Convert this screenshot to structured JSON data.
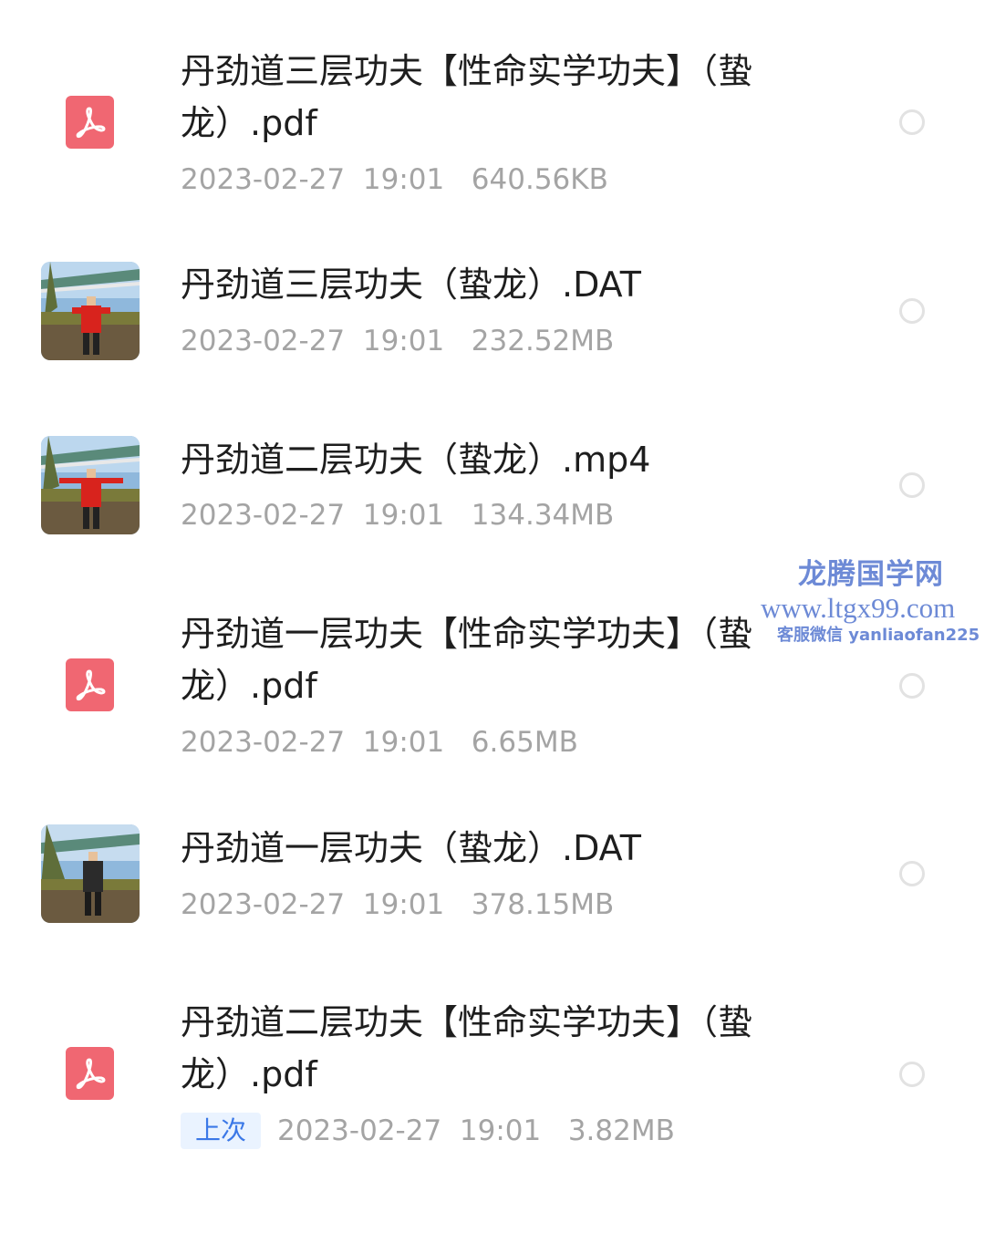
{
  "files": [
    {
      "name": "丹劲道三层功夫【性命实学功夫】（蛰龙）.pdf",
      "date": "2023-02-27",
      "time": "19:01",
      "size": "640.56KB",
      "icon": "pdf-icon"
    },
    {
      "name": "丹劲道三层功夫（蛰龙）.DAT",
      "date": "2023-02-27",
      "time": "19:01",
      "size": "232.52MB",
      "icon": "video-thumbnail"
    },
    {
      "name": "丹劲道二层功夫（蛰龙）.mp4",
      "date": "2023-02-27",
      "time": "19:01",
      "size": "134.34MB",
      "icon": "video-thumbnail"
    },
    {
      "name": "丹劲道一层功夫【性命实学功夫】（蛰龙）.pdf",
      "date": "2023-02-27",
      "time": "19:01",
      "size": "6.65MB",
      "icon": "pdf-icon"
    },
    {
      "name": "丹劲道一层功夫（蛰龙）.DAT",
      "date": "2023-02-27",
      "time": "19:01",
      "size": "378.15MB",
      "icon": "video-thumbnail"
    },
    {
      "name": "丹劲道二层功夫【性命实学功夫】（蛰龙）.pdf",
      "badge": "上次",
      "date": "2023-02-27",
      "time": "19:01",
      "size": "3.82MB",
      "icon": "pdf-icon"
    }
  ],
  "watermark": {
    "title": "龙腾国学网",
    "url": "www.ltgx99.com",
    "wechat": "客服微信 yanliaofan225"
  },
  "colors": {
    "pdf_icon": "#f06772",
    "badge_text": "#3b78e7",
    "badge_bg": "#eaf3ff",
    "meta_text": "#a4a4a4",
    "watermark": "#6d8ad6"
  }
}
